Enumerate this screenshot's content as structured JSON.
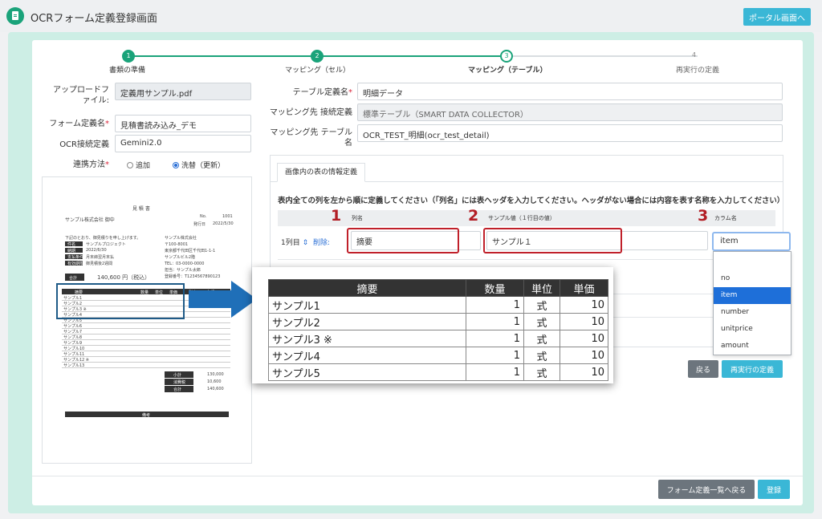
{
  "header": {
    "title": "OCRフォーム定義登録画面",
    "portal_button": "ポータル画面へ",
    "icon": "document-icon"
  },
  "steps": [
    {
      "num": "1",
      "label": "書類の準備"
    },
    {
      "num": "2",
      "label": "マッピング（セル）"
    },
    {
      "num": "3",
      "label": "マッピング（テーブル）"
    },
    {
      "num": "4",
      "label": "再実行の定義"
    }
  ],
  "left_form": {
    "upload_label": "アップロードファイル:",
    "upload_value": "定義用サンプル.pdf",
    "form_name_label": "フォーム定義名",
    "form_name_value": "見積書読み込み_デモ",
    "ocr_label": "OCR接続定義",
    "ocr_value": "Gemini2.0",
    "link_label": "連携方法",
    "radio_add": "追加",
    "radio_replace": "洗替（更新）"
  },
  "doc_preview": {
    "title": "見 積 書",
    "to": "サンプル株式会社 御中",
    "no_label": "No.",
    "no_value": "1001",
    "date_label": "発行日",
    "date_value": "2022/5/30",
    "greeting": "下記のとおり、御見積りを申し上げます。",
    "fields": [
      "件名",
      "納期",
      "支払条件",
      "有効期限"
    ],
    "field_values": [
      "サンプルプロジェクト",
      "2022/6/30",
      "月末締翌月末払",
      "御見積後2週間"
    ],
    "company": [
      "サンプル株式会社",
      "〒100-8001",
      "東京都千代田区千代田1-1-1",
      "サンプルビル2階",
      "TEL：03-0000-0000",
      "担当：サンプル太郎",
      "登録番号：T1234567890123"
    ],
    "amount_label": "合計",
    "amount_value": "140,600 円（税込）",
    "table_head": [
      "摘要",
      "数量",
      "単位",
      "単価",
      "税率",
      "金額"
    ],
    "table_items": [
      "サンプル1",
      "サンプル2",
      "サンプル3 ※",
      "サンプル4",
      "サンプル5",
      "サンプル6",
      "サンプル7",
      "サンプル8",
      "サンプル9",
      "サンプル10",
      "サンプル11",
      "サンプル12 ※",
      "サンプル13"
    ],
    "summary_labels": [
      "小計",
      "消費税",
      "合計"
    ],
    "summary_values": [
      "130,000",
      "10,600",
      "140,600"
    ],
    "note_label": "備考"
  },
  "right_form": {
    "table_name_label": "テーブル定義名",
    "table_name_value": "明細データ",
    "dest_conn_label": "マッピング先 接続定義",
    "dest_conn_value": "標準テーブル（SMART DATA COLLECTOR）",
    "dest_table_label": "マッピング先 テーブル名",
    "dest_table_value": "OCR_TEST_明細(ocr_test_detail)"
  },
  "table_tab": {
    "tab_label": "画像内の表の情報定義",
    "instruction": "表内全ての列を左から順に定義してください（「列名」には表ヘッダを入力してください。ヘッダがない場合には内容を表す名称を入力してください）",
    "col_name_header": "列名",
    "sample_header": "サンプル値（１行目の値）",
    "column_header": "カラム名",
    "row_label": "1列目",
    "delete_label": "削除:",
    "col_name_value": "摘要",
    "sample_value": "サンプル１",
    "column_value": "item",
    "callouts": [
      "1",
      "2",
      "3"
    ]
  },
  "dropdown": {
    "options": [
      "",
      "no",
      "item",
      "number",
      "unitprice",
      "amount"
    ],
    "selected": "item"
  },
  "buttons": {
    "back": "戻る",
    "redefine": "再実行の定義",
    "to_list": "フォーム定義一覧へ戻る",
    "save": "登録"
  },
  "zoom_table": {
    "headers": [
      "摘要",
      "数量",
      "単位",
      "単価"
    ],
    "rows": [
      [
        "サンプル1",
        "1",
        "式",
        "10"
      ],
      [
        "サンプル2",
        "1",
        "式",
        "10"
      ],
      [
        "サンプル3 ※",
        "1",
        "式",
        "10"
      ],
      [
        "サンプル4",
        "1",
        "式",
        "10"
      ],
      [
        "サンプル5",
        "1",
        "式",
        "10"
      ]
    ]
  },
  "colors": {
    "accent": "#1aa37a",
    "button_primary": "#3ab7d6",
    "button_secondary": "#6c757d",
    "frame": "#cdeee5",
    "callout_red": "#c0202a",
    "arrow_blue": "#1f6fb8"
  }
}
